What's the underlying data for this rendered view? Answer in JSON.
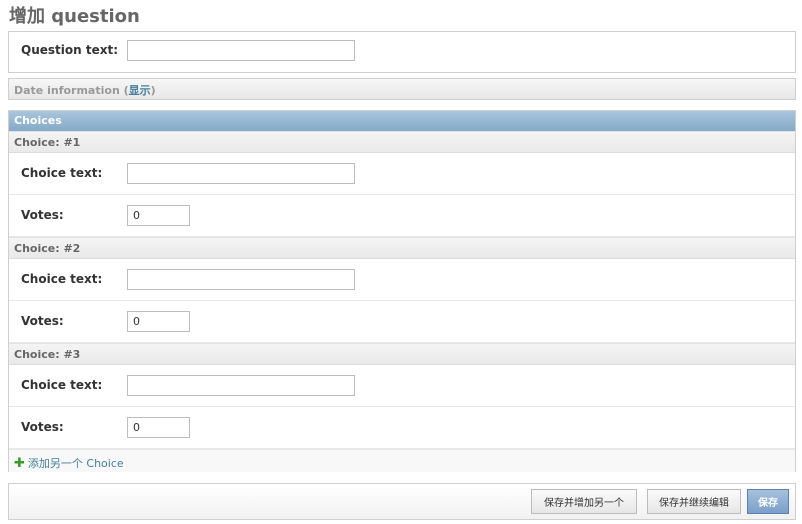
{
  "page": {
    "title": "增加 question"
  },
  "question": {
    "label": "Question text:",
    "value": ""
  },
  "date_info": {
    "label": "Date information",
    "open_paren": "(",
    "toggle": "显示",
    "close_paren": ")"
  },
  "choices": {
    "header": "Choices",
    "items": [
      {
        "title": "Choice: #1",
        "text_label": "Choice text:",
        "text_value": "",
        "votes_label": "Votes:",
        "votes_value": "0"
      },
      {
        "title": "Choice: #2",
        "text_label": "Choice text:",
        "text_value": "",
        "votes_label": "Votes:",
        "votes_value": "0"
      },
      {
        "title": "Choice: #3",
        "text_label": "Choice text:",
        "text_value": "",
        "votes_label": "Votes:",
        "votes_value": "0"
      }
    ],
    "add_link": "添加另一个 Choice"
  },
  "submit": {
    "save_add": "保存并增加另一个",
    "save_continue": "保存并继续编辑",
    "save": "保存"
  },
  "colors": {
    "accent_header": "#84a9c6",
    "link": "#447e9b",
    "add_icon": "#3a9a29",
    "default_button": "#7a9fc9"
  }
}
